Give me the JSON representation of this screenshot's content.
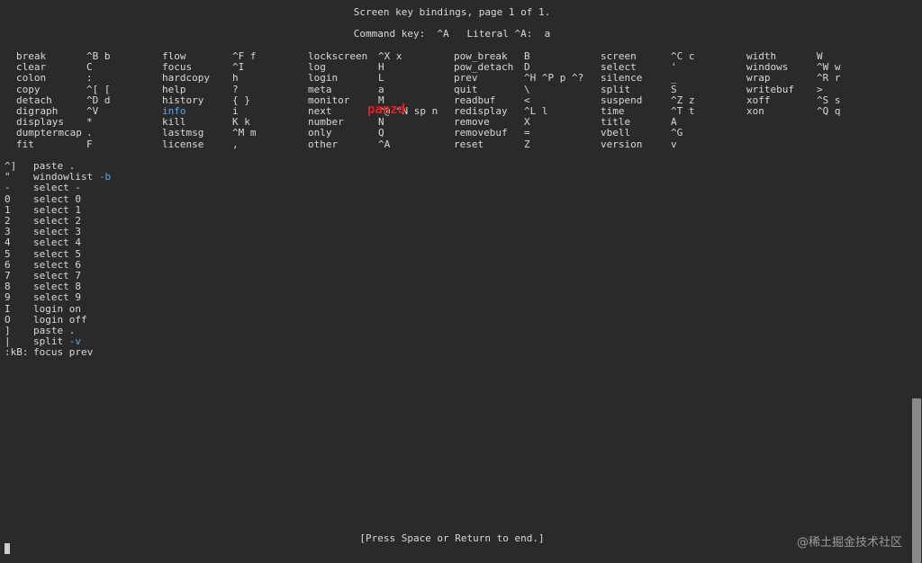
{
  "header": {
    "title": "Screen key bindings, page 1 of 1.",
    "command_line": "Command key:  ^A   Literal ^A:  a"
  },
  "bindings_table": {
    "columns": [
      [
        [
          "break",
          "^B b"
        ],
        [
          "clear",
          "C"
        ],
        [
          "colon",
          ":"
        ],
        [
          "copy",
          "^[ ["
        ],
        [
          "detach",
          "^D d"
        ],
        [
          "digraph",
          "^V"
        ],
        [
          "displays",
          "*"
        ],
        [
          "dumptermcap",
          "."
        ],
        [
          "fit",
          "F"
        ]
      ],
      [
        [
          "flow",
          "^F f"
        ],
        [
          "focus",
          "^I"
        ],
        [
          "hardcopy",
          "h"
        ],
        [
          "help",
          "?"
        ],
        [
          "history",
          "{ }"
        ],
        [
          "info",
          "i"
        ],
        [
          "kill",
          "K k"
        ],
        [
          "lastmsg",
          "^M m"
        ],
        [
          "license",
          ","
        ]
      ],
      [
        [
          "lockscreen",
          "^X x"
        ],
        [
          "log",
          "H"
        ],
        [
          "login",
          "L"
        ],
        [
          "meta",
          "a"
        ],
        [
          "monitor",
          "M"
        ],
        [
          "next",
          "^@ ^N sp n"
        ],
        [
          "number",
          "N"
        ],
        [
          "only",
          "Q"
        ],
        [
          "other",
          "^A"
        ]
      ],
      [
        [
          "pow_break",
          "B"
        ],
        [
          "pow_detach",
          "D"
        ],
        [
          "prev",
          "^H ^P p ^?"
        ],
        [
          "quit",
          "\\"
        ],
        [
          "readbuf",
          "<"
        ],
        [
          "redisplay",
          "^L l"
        ],
        [
          "remove",
          "X"
        ],
        [
          "removebuf",
          "="
        ],
        [
          "reset",
          "Z"
        ]
      ],
      [
        [
          "screen",
          "^C c"
        ],
        [
          "select",
          "'"
        ],
        [
          "silence",
          "_"
        ],
        [
          "split",
          "S"
        ],
        [
          "suspend",
          "^Z z"
        ],
        [
          "time",
          "^T t"
        ],
        [
          "title",
          "A"
        ],
        [
          "vbell",
          "^G"
        ],
        [
          "version",
          "v"
        ]
      ],
      [
        [
          "width",
          "W"
        ],
        [
          "windows",
          "^W w"
        ],
        [
          "wrap",
          "^R r"
        ],
        [
          "writebuf",
          ">"
        ],
        [
          "xoff",
          "^S s"
        ],
        [
          "xon",
          "^Q q"
        ]
      ]
    ]
  },
  "extra_bindings": [
    {
      "key": "^]",
      "cmd": "paste ."
    },
    {
      "key": "\"",
      "cmd": "windowlist",
      "arg": "-b"
    },
    {
      "key": "-",
      "cmd": "select -"
    },
    {
      "key": "0",
      "cmd": "select 0"
    },
    {
      "key": "1",
      "cmd": "select 1"
    },
    {
      "key": "2",
      "cmd": "select 2"
    },
    {
      "key": "3",
      "cmd": "select 3"
    },
    {
      "key": "4",
      "cmd": "select 4"
    },
    {
      "key": "5",
      "cmd": "select 5"
    },
    {
      "key": "6",
      "cmd": "select 6"
    },
    {
      "key": "7",
      "cmd": "select 7"
    },
    {
      "key": "8",
      "cmd": "select 8"
    },
    {
      "key": "9",
      "cmd": "select 9"
    },
    {
      "key": "I",
      "cmd": "login on"
    },
    {
      "key": "O",
      "cmd": "login off"
    },
    {
      "key": "]",
      "cmd": "paste ."
    },
    {
      "key": "|",
      "cmd": "split",
      "arg": "-v"
    },
    {
      "key": ":kB:",
      "cmd": "focus prev"
    }
  ],
  "overlay_text": "panzd",
  "footer": "[Press Space or Return to end.]",
  "watermark": "@稀土掘金技术社区",
  "colors": {
    "background": "#2a2a2a",
    "text": "#d8d8d8",
    "highlight": "#5aa8e6",
    "overlay": "#e02020"
  }
}
